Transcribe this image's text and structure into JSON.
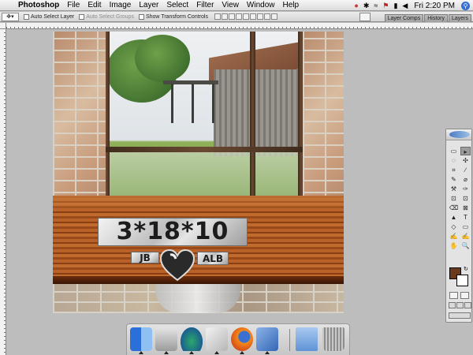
{
  "menubar": {
    "apple_glyph": "",
    "app_name": "Photoshop",
    "menus": [
      "File",
      "Edit",
      "Image",
      "Layer",
      "Select",
      "Filter",
      "View",
      "Window",
      "Help"
    ],
    "clock": "Fri 2:20 PM",
    "status_icons": [
      "tomato-icon",
      "bluetooth-icon",
      "wifi-icon",
      "flag-icon",
      "battery-icon",
      "volume-icon",
      "spotlight-icon"
    ]
  },
  "options": {
    "auto_select_layer": "Auto Select Layer",
    "auto_select_groups": "Auto Select Groups",
    "show_transform": "Show Transform Controls"
  },
  "palette_well": {
    "tabs": [
      "Layer Comps",
      "History",
      "Layers"
    ]
  },
  "canvas": {
    "date_text": "3*18*10",
    "initials_left": "JB",
    "initials_right": "ALB"
  },
  "tools": {
    "glyphs": [
      "▭",
      "▸",
      "◌",
      "✣",
      "⌗",
      "∕",
      "✎",
      "⌀",
      "⚒",
      "✑",
      "⊡",
      "⊡",
      "⌫",
      "⊠",
      "▲",
      "◉",
      "◇",
      "T",
      "▸",
      "▭",
      "✋",
      "✍",
      "✍",
      "🔍"
    ]
  },
  "dock": {
    "items": [
      "finder-icon",
      "system-preferences-icon",
      "mail-icon",
      "preview-icon",
      "firefox-icon",
      "safari-icon",
      "documents-folder-icon",
      "trash-icon"
    ]
  },
  "colors": {
    "foreground": "#6b3a1c",
    "background": "#ffffff",
    "accent": "#2f6fd6"
  }
}
